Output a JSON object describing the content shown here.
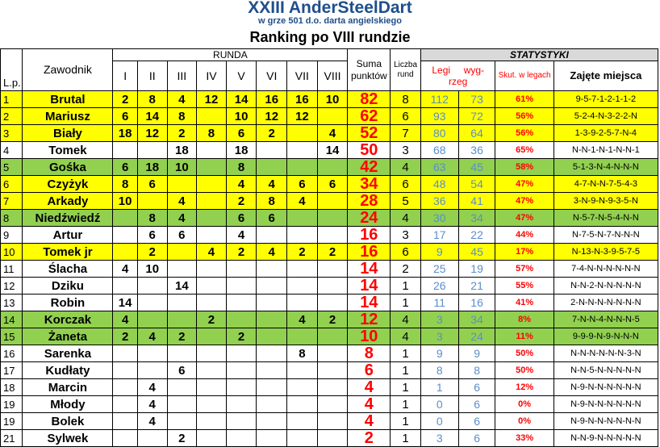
{
  "title": "XXIII AnderSteelDart",
  "subtitle": "w grze 501 d.o. darta angielskiego",
  "ranking_title": "Ranking po VIII rundzie",
  "headers": {
    "lp": "L.p.",
    "player": "Zawodnik",
    "runda": "RUNDA",
    "rounds": [
      "I",
      "II",
      "III",
      "IV",
      "V",
      "VI",
      "VII",
      "VIII"
    ],
    "sum": "Suma punktów",
    "count": "Liczba rund",
    "statystyki": "STATYSTYKI",
    "legi": "Legi",
    "legi_won": "wyg-",
    "legi_played": "rzeg",
    "skut": "Skut. w legach",
    "places": "Zajęte miejsca"
  },
  "rows": [
    {
      "lp": "1",
      "name": "Brutal",
      "rounds": [
        "2",
        "8",
        "4",
        "12",
        "14",
        "16",
        "16",
        "10"
      ],
      "sum": "82",
      "count": "8",
      "legs_a": "112",
      "legs_b": "73",
      "eff": "61%",
      "places": "9-5-7-1-2-1-1-2",
      "color": "yellow"
    },
    {
      "lp": "2",
      "name": "Mariusz",
      "rounds": [
        "6",
        "14",
        "8",
        "",
        "10",
        "12",
        "12",
        ""
      ],
      "sum": "62",
      "count": "6",
      "legs_a": "93",
      "legs_b": "72",
      "eff": "56%",
      "places": "5-2-4-N-3-2-2-N",
      "color": "yellow"
    },
    {
      "lp": "3",
      "name": "Biały",
      "rounds": [
        "18",
        "12",
        "2",
        "8",
        "6",
        "2",
        "",
        "4"
      ],
      "sum": "52",
      "count": "7",
      "legs_a": "80",
      "legs_b": "64",
      "eff": "56%",
      "places": "1-3-9-2-5-7-N-4",
      "color": "yellow"
    },
    {
      "lp": "4",
      "name": "Tomek",
      "rounds": [
        "",
        "",
        "18",
        "",
        "18",
        "",
        "",
        "14"
      ],
      "sum": "50",
      "count": "3",
      "legs_a": "68",
      "legs_b": "36",
      "eff": "65%",
      "places": "N-N-1-N-1-N-N-1",
      "color": "white"
    },
    {
      "lp": "5",
      "name": "Gośka",
      "rounds": [
        "6",
        "18",
        "10",
        "",
        "8",
        "",
        "",
        ""
      ],
      "sum": "42",
      "count": "4",
      "legs_a": "63",
      "legs_b": "45",
      "eff": "58%",
      "places": "5-1-3-N-4-N-N-N",
      "color": "green"
    },
    {
      "lp": "6",
      "name": "Czyżyk",
      "rounds": [
        "8",
        "6",
        "",
        "",
        "4",
        "4",
        "6",
        "6"
      ],
      "sum": "34",
      "count": "6",
      "legs_a": "48",
      "legs_b": "54",
      "eff": "47%",
      "places": "4-7-N-N-7-5-4-3",
      "color": "yellow"
    },
    {
      "lp": "7",
      "name": "Arkady",
      "rounds": [
        "10",
        "",
        "4",
        "",
        "2",
        "8",
        "4",
        ""
      ],
      "sum": "28",
      "count": "5",
      "legs_a": "36",
      "legs_b": "41",
      "eff": "47%",
      "places": "3-N-9-N-9-3-5-N",
      "color": "yellow"
    },
    {
      "lp": "8",
      "name": "Niedźwiedź",
      "rounds": [
        "",
        "8",
        "4",
        "",
        "6",
        "6",
        "",
        ""
      ],
      "sum": "24",
      "count": "4",
      "legs_a": "30",
      "legs_b": "34",
      "eff": "47%",
      "places": "N-5-7-N-5-4-N-N",
      "color": "green"
    },
    {
      "lp": "9",
      "name": "Artur",
      "rounds": [
        "",
        "6",
        "6",
        "",
        "4",
        "",
        "",
        ""
      ],
      "sum": "16",
      "count": "3",
      "legs_a": "17",
      "legs_b": "22",
      "eff": "44%",
      "places": "N-7-5-N-7-N-N-N",
      "color": "white"
    },
    {
      "lp": "10",
      "name": "Tomek jr",
      "rounds": [
        "",
        "2",
        "",
        "4",
        "2",
        "4",
        "2",
        "2"
      ],
      "sum": "16",
      "count": "6",
      "legs_a": "9",
      "legs_b": "45",
      "eff": "17%",
      "places": "N-13-N-3-9-5-7-5",
      "color": "yellow"
    },
    {
      "lp": "11",
      "name": "Ślacha",
      "rounds": [
        "4",
        "10",
        "",
        "",
        "",
        "",
        "",
        ""
      ],
      "sum": "14",
      "count": "2",
      "legs_a": "25",
      "legs_b": "19",
      "eff": "57%",
      "places": "7-4-N-N-N-N-N-N",
      "color": "white"
    },
    {
      "lp": "12",
      "name": "Dziku",
      "rounds": [
        "",
        "",
        "14",
        "",
        "",
        "",
        "",
        ""
      ],
      "sum": "14",
      "count": "1",
      "legs_a": "26",
      "legs_b": "21",
      "eff": "55%",
      "places": "N-N-2-N-N-N-N-N",
      "color": "white"
    },
    {
      "lp": "13",
      "name": "Robin",
      "rounds": [
        "14",
        "",
        "",
        "",
        "",
        "",
        "",
        ""
      ],
      "sum": "14",
      "count": "1",
      "legs_a": "11",
      "legs_b": "16",
      "eff": "41%",
      "places": "2-N-N-N-N-N-N-N",
      "color": "white"
    },
    {
      "lp": "14",
      "name": "Korczak",
      "rounds": [
        "4",
        "",
        "",
        "2",
        "",
        "",
        "4",
        "2"
      ],
      "sum": "12",
      "count": "4",
      "legs_a": "3",
      "legs_b": "34",
      "eff": "8%",
      "places": "7-N-N-4-N-N-N-5",
      "color": "green"
    },
    {
      "lp": "15",
      "name": "Żaneta",
      "rounds": [
        "2",
        "4",
        "2",
        "",
        "2",
        "",
        "",
        ""
      ],
      "sum": "10",
      "count": "4",
      "legs_a": "3",
      "legs_b": "24",
      "eff": "11%",
      "places": "9-9-9-N-9-N-N-N",
      "color": "green"
    },
    {
      "lp": "16",
      "name": "Sarenka",
      "rounds": [
        "",
        "",
        "",
        "",
        "",
        "",
        "8",
        ""
      ],
      "sum": "8",
      "count": "1",
      "legs_a": "9",
      "legs_b": "9",
      "eff": "50%",
      "places": "N-N-N-N-N-N-3-N",
      "color": "white"
    },
    {
      "lp": "17",
      "name": "Kudłaty",
      "rounds": [
        "",
        "",
        "6",
        "",
        "",
        "",
        "",
        ""
      ],
      "sum": "6",
      "count": "1",
      "legs_a": "8",
      "legs_b": "8",
      "eff": "50%",
      "places": "N-N-5-N-N-N-N-N",
      "color": "white"
    },
    {
      "lp": "18",
      "name": "Marcin",
      "rounds": [
        "",
        "4",
        "",
        "",
        "",
        "",
        "",
        ""
      ],
      "sum": "4",
      "count": "1",
      "legs_a": "1",
      "legs_b": "6",
      "eff": "12%",
      "places": "N-9-N-N-N-N-N-N",
      "color": "white"
    },
    {
      "lp": "19",
      "name": "Młody",
      "rounds": [
        "",
        "4",
        "",
        "",
        "",
        "",
        "",
        ""
      ],
      "sum": "4",
      "count": "1",
      "legs_a": "0",
      "legs_b": "6",
      "eff": "0%",
      "places": "N-9-N-N-N-N-N-N",
      "color": "white"
    },
    {
      "lp": "19",
      "name": "Bolek",
      "rounds": [
        "",
        "4",
        "",
        "",
        "",
        "",
        "",
        ""
      ],
      "sum": "4",
      "count": "1",
      "legs_a": "0",
      "legs_b": "6",
      "eff": "0%",
      "places": "N-9-N-N-N-N-N-N",
      "color": "white"
    },
    {
      "lp": "21",
      "name": "Sylwek",
      "rounds": [
        "",
        "",
        "2",
        "",
        "",
        "",
        "",
        ""
      ],
      "sum": "2",
      "count": "1",
      "legs_a": "3",
      "legs_b": "6",
      "eff": "33%",
      "places": "N-N-9-N-N-N-N-N",
      "color": "white"
    }
  ]
}
